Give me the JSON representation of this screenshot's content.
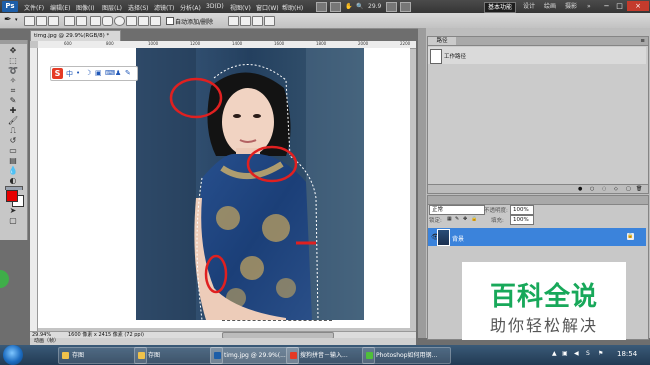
{
  "menubar": {
    "logo": "Ps",
    "items": [
      "文件(F)",
      "编辑(E)",
      "图像(I)",
      "图层(L)",
      "选择(S)",
      "滤镜(T)",
      "分析(A)",
      "3D(D)",
      "视图(V)",
      "窗口(W)",
      "帮助(H)"
    ],
    "zoom": "29.9",
    "workspaces": [
      "基本功能",
      "设计",
      "绘画",
      "摄影"
    ],
    "more": "»",
    "window_controls": [
      "−",
      "□",
      "×"
    ]
  },
  "options": {
    "auto_erase_label": "自动添加/删除"
  },
  "document": {
    "tab_title": "timg.jpg @ 29.9%(RGB/8) *",
    "ruler_ticks": [
      "600",
      "800",
      "1000",
      "1200",
      "1400",
      "1600",
      "1800",
      "2000",
      "2200"
    ],
    "status_zoom": "29.94%",
    "status_size": "1600 像素 x 2415 像素 (72 ppi)",
    "status_mode": "动画（帧）"
  },
  "ime": {
    "logo": "S",
    "icons": [
      "中",
      "•",
      "☽",
      "▣",
      "⌨",
      "♟",
      "✎"
    ]
  },
  "history": {
    "title": "路径",
    "item": "工作路径"
  },
  "layers": {
    "blend_mode": "正常",
    "opacity_label": "不透明度:",
    "opacity_value": "100%",
    "lock_label": "锁定:",
    "fill_label": "填充:",
    "fill_value": "100%",
    "layer_name": "背景"
  },
  "watermark": {
    "line1": "百科全说",
    "line2": "助你轻松解决"
  },
  "taskbar": {
    "items": [
      "存图",
      "存图",
      "timg.jpg @ 29.9%(...",
      "搜狗拼音－输入...",
      "Photoshop如何用钢..."
    ],
    "clock": "18:54"
  }
}
